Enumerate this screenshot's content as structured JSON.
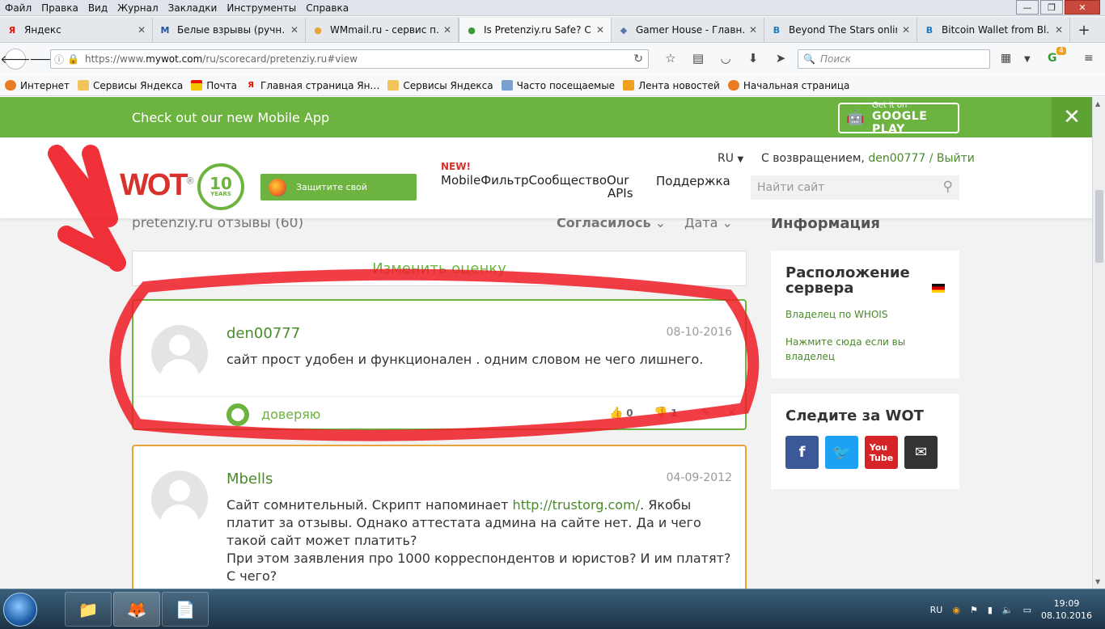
{
  "menu": [
    "Файл",
    "Правка",
    "Вид",
    "Журнал",
    "Закладки",
    "Инструменты",
    "Справка"
  ],
  "tabs": [
    {
      "title": "Яндекс",
      "icon": "Я",
      "color": "#e61400"
    },
    {
      "title": "Белые взрывы (ручн…",
      "icon": "M",
      "color": "#2454a4"
    },
    {
      "title": "WMmail.ru - сервис п…",
      "icon": "●",
      "color": "#e8a33a"
    },
    {
      "title": "Is Pretenziy.ru Safe? C…",
      "icon": "●",
      "color": "#3a9a38"
    },
    {
      "title": "Gamer House - Главн…",
      "icon": "◆",
      "color": "#5577aa"
    },
    {
      "title": "Beyond The Stars online",
      "icon": "B",
      "color": "#1a7bc0"
    },
    {
      "title": "Bitcoin Wallet from Bl…",
      "icon": "B",
      "color": "#1a7bc0"
    }
  ],
  "url": {
    "prefix": "https://www.",
    "domain": "mywot.com",
    "path": "/ru/scorecard/pretenziy.ru#view"
  },
  "search_placeholder": "Поиск",
  "addon_count": "4",
  "bookmarks": [
    "Интернет",
    "Сервисы Яндекса",
    "Почта",
    "Главная страница Ян…",
    "Сервисы Яндекса",
    "Часто посещаемые",
    "Лента новостей",
    "Начальная страница"
  ],
  "banner": {
    "message": "Check out our new Mobile App",
    "gp_line1": "Get it on",
    "gp_line2": "GOOGLE PLAY"
  },
  "header": {
    "logo": "WOT",
    "logo_reg": "®",
    "badge_num": "10",
    "badge_txt": "YEARS",
    "protect": "Защитите свой",
    "new": "NEW!",
    "nav_main": "MobileФильтрСообществоOur",
    "nav_api": "APIs",
    "nav_support": "Поддержка",
    "lang": "RU",
    "welcome": "С возвращением,",
    "user": "den00777",
    "logout": "/ Выйти",
    "search": "Найти сайт"
  },
  "reviews": {
    "title": "pretenziy.ru отзывы (60)",
    "sort1": "Согласилось",
    "sort2": "Дата",
    "change": "Изменить оценку"
  },
  "review1": {
    "user": "den00777",
    "date": "08-10-2016",
    "text": "сайт прост удобен и функционален . одним словом не чего лишнего.",
    "trust": "доверяю",
    "up": "0",
    "down": "1"
  },
  "review2": {
    "user": "Mbells",
    "date": "04-09-2012",
    "t1": "Сайт сомнительный. Скрипт напоминает ",
    "link": "http://trustorg.com/",
    "t2": ". Якобы платит за отзывы. Однако аттестата админа на сайте нет. Да и чего такой сайт может платить?",
    "t3": "При этом заявления про 1000 корреспондентов и юристов? И им платят? С чего?"
  },
  "info": {
    "title": "Информация",
    "server": "Расположение сервера",
    "whois": "Владелец по WHOIS",
    "claim": "Нажмите сюда если вы владелец",
    "follow": "Следите за WOT"
  },
  "tray": {
    "lang": "RU",
    "time": "19:09",
    "date": "08.10.2016"
  }
}
